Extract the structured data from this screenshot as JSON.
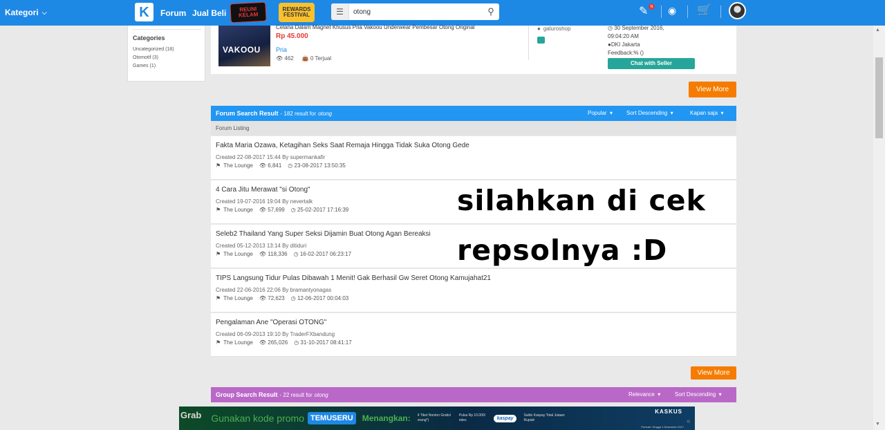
{
  "topbar": {
    "kategori_label": "Kategori",
    "logo_letter": "K",
    "nav_forum": "Forum",
    "nav_jualbeli": "Jual Beli",
    "promo_reuni": "REUNI KELAM",
    "promo_rewards": "REWARDS FESTIVAL",
    "search_value": "otong",
    "notif_count": "N"
  },
  "sidebar": {
    "heading": "Categories",
    "items": [
      "Uncategorized (18)",
      "Otomotif (3)",
      "Games (1)"
    ]
  },
  "product": {
    "title": "Celana Dalam Magnet Khusus Pria Vakoou Underwear Pembesar Otong Original",
    "image_text": "VAKOOU",
    "price": "Rp 45.000",
    "category": "Pria",
    "views": "462",
    "sold": "0 Terjual",
    "seller": "galuroshop",
    "date_line1": "30 September 2016,",
    "date_line2": "09:04:20 AM",
    "location": "DKI Jakarta",
    "feedback": "Feedback:% ()",
    "chat_label": "Chat with Seller"
  },
  "view_more_label": "View More",
  "forum_panel": {
    "title": "Forum Search Result",
    "count_text": "- 182 result for",
    "keyword": "otong",
    "sort_popular": "Popular",
    "sort_desc": "Sort Descending",
    "sort_time": "Kapan saja",
    "listing_label": "Forum Listing",
    "threads": [
      {
        "title": "Fakta Maria Ozawa, Ketagihan Seks Saat Remaja Hingga Tidak Suka Otong Gede",
        "created": "Created 22-08-2017 15:44 By supermankafir",
        "forum": "The Lounge",
        "views": "6,841",
        "last": "23-08-2017 13:50:35"
      },
      {
        "title": "4 Cara Jitu Merawat \"si Otong\"",
        "created": "Created 19-07-2016 19:04 By nevertalk",
        "forum": "The Lounge",
        "views": "57,699",
        "last": "25-02-2017 17:16:39"
      },
      {
        "title": "Seleb2 Thailand Yang Super Seksi Dijamin Buat Otong Agan Bereaksi",
        "created": "Created 05-12-2013 13:14 By ditiduri",
        "forum": "The Lounge",
        "views": "118,336",
        "last": "16-02-2017 06:23:17"
      },
      {
        "title": "TIPS Langsung Tidur Pulas Dibawah 1 Menit! Gak Berhasil Gw Seret Otong Kamujahat21",
        "created": "Created 22-06-2016 22:06 By bramantyonagas",
        "forum": "The Lounge",
        "views": "72,623",
        "last": "12-06-2017 00:04:03"
      },
      {
        "title": "Pengalaman Ane \"Operasi OTONG\"",
        "created": "Created 06-09-2013 19:10 By TraderFXbandung",
        "forum": "The Lounge",
        "views": "265,026",
        "last": "31-10-2017 08:41:17"
      }
    ]
  },
  "overlay": {
    "line1": "silahkan di cek",
    "line2": "repsolnya :D"
  },
  "group_panel": {
    "title": "Group Search Result",
    "count_text": "- 22 result for",
    "keyword": "otong",
    "sort_relevance": "Relevance",
    "sort_desc": "Sort Descending"
  },
  "ad": {
    "grab": "Grab",
    "gunakan": "Gunakan kode promo",
    "code": "TEMUSERU",
    "menangkan": "Menangkan:",
    "prize1": "4 Tiket Nonton Gratis/ orang*)",
    "prize2": "Pulsa Rp 10.000/ ndes",
    "kaspay": "kaspay",
    "prize3": "Saldo Kaspay Total Jutaan Rupiah",
    "kaskus": "KASKUS",
    "period": "Periode: Hingga 1 Desember 2017"
  },
  "colors": {
    "topbar": "#1e88e5",
    "forum_header": "#2196f3",
    "group_header": "#ba68c8",
    "view_more": "#f57c00",
    "chat_button": "#26a69a",
    "price": "#e53935"
  }
}
